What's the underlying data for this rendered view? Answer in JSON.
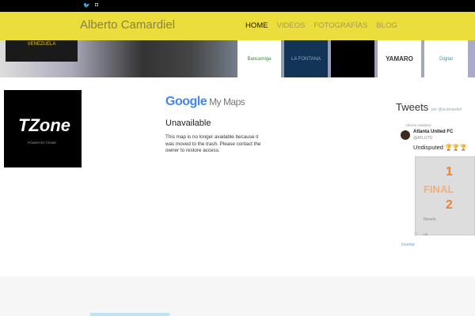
{
  "topbar": {
    "icons": [
      "twitter-icon",
      "instagram-icon"
    ]
  },
  "header": {
    "brand": "Alberto Camardiel",
    "nav": [
      "HOME",
      "VIDEOS",
      "FOTOGRAFÍAS",
      "BLOG"
    ]
  },
  "banner": {
    "left_text": "VENEZUELA",
    "sponsors": [
      "Bancamiga",
      "LA FONTANA",
      "",
      "YAMARO",
      "Digital"
    ]
  },
  "tzone": {
    "logo": "TZone",
    "tagline": "POWER BY TZONE"
  },
  "maps": {
    "google": "Google",
    "product": "My Maps",
    "title": "Unavailable",
    "message": "This map is no longer available because it was moved to the trash. Please contact the owner to restore access."
  },
  "tweets": {
    "title": "Tweets",
    "by": "por @acamardiel",
    "retweeted": "Alberto retwitted",
    "name": "Atlanta United FC",
    "handle": "@ATLUTD",
    "text": "Undisputed 🏆🏆🏆",
    "media": [
      "1",
      "FINAL",
      "2",
      "Novelo"
    ],
    "embed": "Insertar"
  }
}
